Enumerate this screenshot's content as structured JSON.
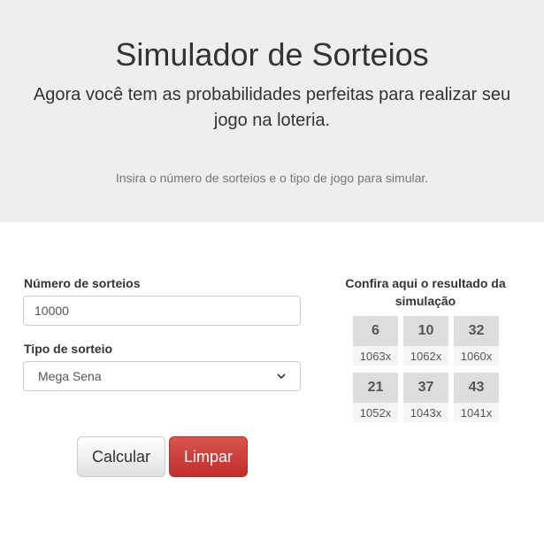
{
  "header": {
    "title": "Simulador de Sorteios",
    "lead": "Agora você tem as probabilidades perfeitas para realizar seu jogo na loteria.",
    "hint": "Insira o número de sorteios e o tipo de jogo para simular."
  },
  "form": {
    "draws_label": "Número de sorteios",
    "draws_value": "10000",
    "type_label": "Tipo de sorteio",
    "type_selected": "Mega Sena",
    "calc_label": "Calcular",
    "clear_label": "Limpar"
  },
  "results": {
    "title": "Confira aqui o resultado da simulação",
    "balls": [
      {
        "number": "6",
        "count": "1063x"
      },
      {
        "number": "10",
        "count": "1062x"
      },
      {
        "number": "32",
        "count": "1060x"
      },
      {
        "number": "21",
        "count": "1052x"
      },
      {
        "number": "37",
        "count": "1043x"
      },
      {
        "number": "43",
        "count": "1041x"
      }
    ]
  },
  "icons": {
    "select_arrow": "chevron-down-icon"
  },
  "colors": {
    "hero_background": "#eeeeee",
    "clear_button": "#d9534f",
    "ball_background": "#dddddd"
  }
}
